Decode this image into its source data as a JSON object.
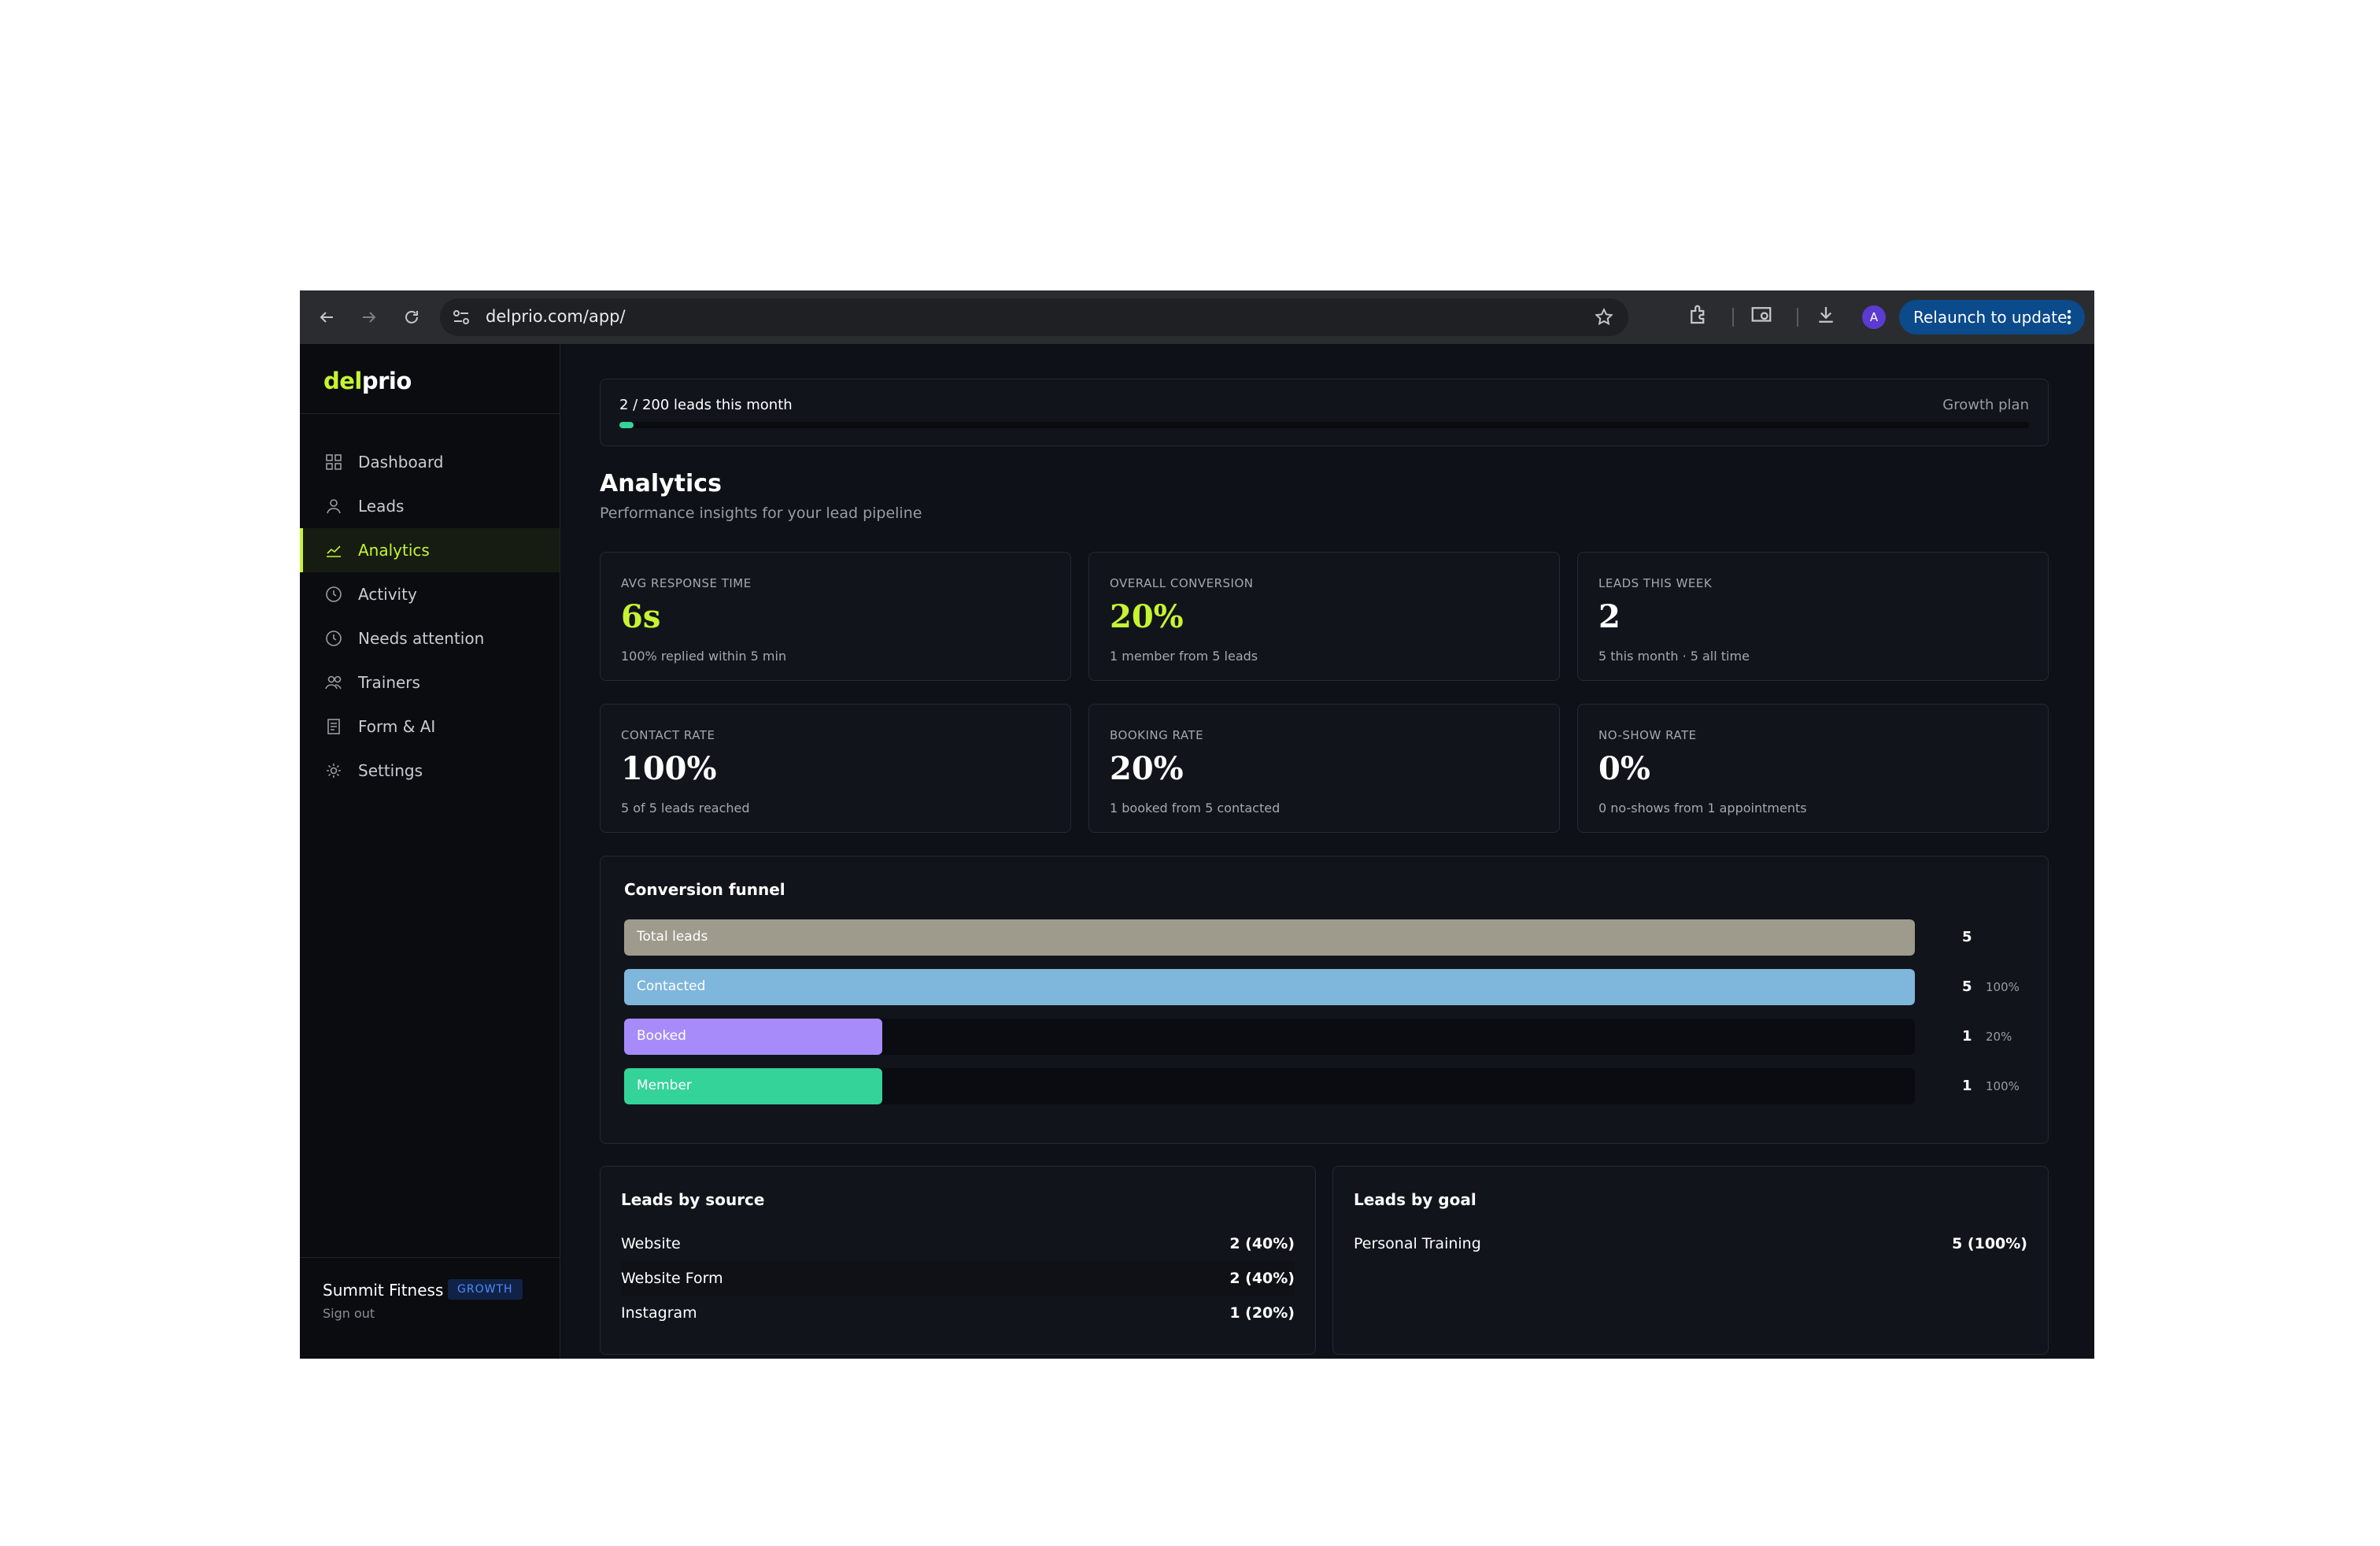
{
  "browser": {
    "url": "delprio.com/app/",
    "avatar_letter": "A",
    "relaunch_label": "Relaunch to update"
  },
  "sidebar": {
    "logo_accent": "del",
    "logo_rest": "prio",
    "items": [
      {
        "label": "Dashboard",
        "icon": "grid-icon"
      },
      {
        "label": "Leads",
        "icon": "user-icon"
      },
      {
        "label": "Analytics",
        "icon": "chart-line-icon",
        "active": true
      },
      {
        "label": "Activity",
        "icon": "clock-icon"
      },
      {
        "label": "Needs attention",
        "icon": "clock-alert-icon"
      },
      {
        "label": "Trainers",
        "icon": "users-icon"
      },
      {
        "label": "Form & AI",
        "icon": "document-icon"
      },
      {
        "label": "Settings",
        "icon": "gear-icon"
      }
    ],
    "org_name": "Summit Fitness",
    "plan_badge": "GROWTH",
    "sign_out": "Sign out"
  },
  "usage": {
    "text": "2 / 200 leads this month",
    "plan": "Growth plan",
    "used": 2,
    "limit": 200
  },
  "header": {
    "title": "Analytics",
    "subtitle": "Performance insights for your lead pipeline"
  },
  "stats": [
    {
      "label": "AVG RESPONSE TIME",
      "value": "6s",
      "sub": "100% replied within 5 min",
      "accent": true
    },
    {
      "label": "OVERALL CONVERSION",
      "value": "20%",
      "sub": "1 member from 5 leads",
      "accent": true
    },
    {
      "label": "LEADS THIS WEEK",
      "value": "2",
      "sub": "5 this month · 5 all time",
      "accent": false
    },
    {
      "label": "CONTACT RATE",
      "value": "100%",
      "sub": "5 of 5 leads reached",
      "accent": false
    },
    {
      "label": "BOOKING RATE",
      "value": "20%",
      "sub": "1 booked from 5 contacted",
      "accent": false
    },
    {
      "label": "NO-SHOW RATE",
      "value": "0%",
      "sub": "0 no-shows from 1 appointments",
      "accent": false
    }
  ],
  "funnel": {
    "title": "Conversion funnel",
    "max": 5,
    "stages": [
      {
        "label": "Total leads",
        "count": "5",
        "value": 5,
        "pct": "",
        "color": "#9e9a8c"
      },
      {
        "label": "Contacted",
        "count": "5",
        "value": 5,
        "pct": "100%",
        "color": "#7fb6dc"
      },
      {
        "label": "Booked",
        "count": "1",
        "value": 1,
        "pct": "20%",
        "color": "#a78bfa"
      },
      {
        "label": "Member",
        "count": "1",
        "value": 1,
        "pct": "100%",
        "color": "#34d399"
      }
    ]
  },
  "leads_by_source": {
    "title": "Leads by source",
    "rows": [
      {
        "name": "Website",
        "value": "2 (40%)"
      },
      {
        "name": "Website Form",
        "value": "2 (40%)"
      },
      {
        "name": "Instagram",
        "value": "1 (20%)"
      }
    ]
  },
  "leads_by_goal": {
    "title": "Leads by goal",
    "rows": [
      {
        "name": "Personal Training",
        "value": "5 (100%)"
      }
    ]
  }
}
